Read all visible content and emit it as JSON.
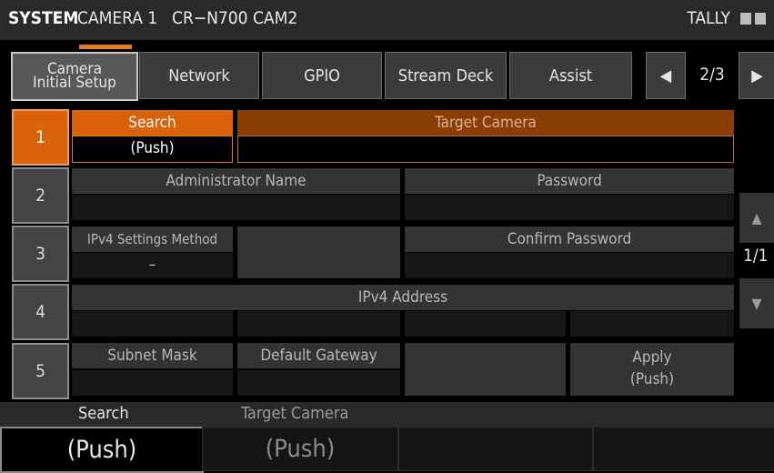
{
  "titlebar": {
    "system": "SYSTEM",
    "camera": "CAMERA 1",
    "model": "CR−N700 CAM2",
    "tally": "TALLY"
  },
  "tabs": {
    "camera_initial_setup_line1": "Camera",
    "camera_initial_setup_line2": "Initial Setup",
    "network": "Network",
    "gpio": "GPIO",
    "stream_deck": "Stream Deck",
    "assist": "Assist",
    "prev_icon": "◀",
    "page": "2/3",
    "next_icon": "▶"
  },
  "rows": {
    "row1": {
      "number": "1",
      "search_label": "Search",
      "search_value": "(Push)",
      "target_label": "Target Camera",
      "target_value": ""
    },
    "row2": {
      "number": "2",
      "admin_label": "Administrator Name",
      "admin_value": "",
      "password_label": "Password",
      "password_value": ""
    },
    "row3": {
      "number": "3",
      "ipv4_method_label": "IPv4 Settings Method",
      "ipv4_method_value": "–",
      "confirm_label": "Confirm Password",
      "confirm_value": ""
    },
    "row4": {
      "number": "4",
      "ipv4_address_label": "IPv4 Address"
    },
    "row5": {
      "number": "5",
      "subnet_label": "Subnet Mask",
      "gateway_label": "Default Gateway",
      "apply_line1": "Apply",
      "apply_line2": "(Push)"
    }
  },
  "scroll": {
    "up_icon": "▲",
    "page": "1/1",
    "down_icon": "▼"
  },
  "bottom": {
    "label1": "Search",
    "label2": "Target Camera",
    "key1": "(Push)",
    "key2": "(Push)"
  }
}
